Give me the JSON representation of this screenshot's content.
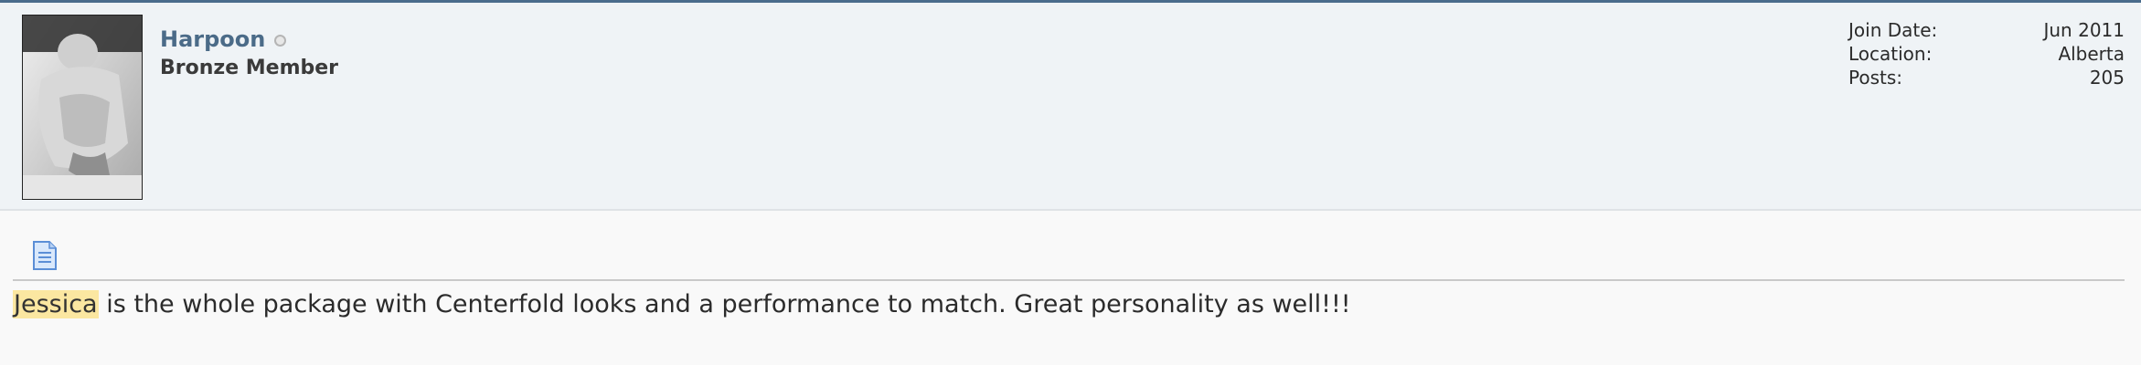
{
  "user": {
    "username": "Harpoon",
    "title": "Bronze Member",
    "online_status_icon": "offline-status-icon"
  },
  "stats": [
    {
      "label": "Join Date:",
      "value": "Jun 2011"
    },
    {
      "label": "Location:",
      "value": "Alberta"
    },
    {
      "label": "Posts:",
      "value": "205"
    }
  ],
  "post": {
    "icon": "document-icon",
    "highlighted_term": "Jessica",
    "message_rest": " is the whole package with Centerfold looks and a performance to match. Great personality as well!!!"
  },
  "colors": {
    "accent_border": "#4a6c8c",
    "username": "#4b6b88",
    "header_bg": "#eff3f6",
    "highlight": "#fbe7a1"
  }
}
